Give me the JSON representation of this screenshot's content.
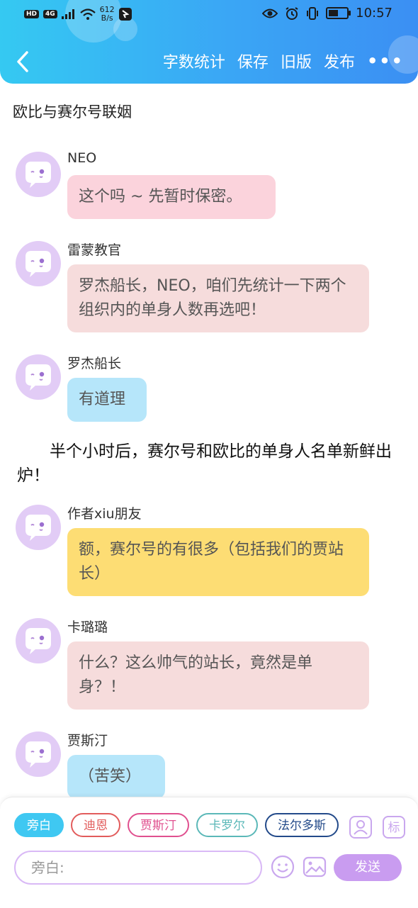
{
  "status_bar": {
    "hd": "HD",
    "net": "4G",
    "speed_value": "612",
    "speed_unit": "B/s",
    "time": "10:57",
    "battery_level": 0.55
  },
  "header": {
    "actions": [
      "字数统计",
      "保存",
      "旧版",
      "发布"
    ],
    "more": "•••"
  },
  "doc_title": "欧比与赛尔号联姻",
  "messages": [
    {
      "name": "NEO",
      "text": "这个吗 ~ 先暂时保密。",
      "color": "#fbd3dc"
    },
    {
      "name": "雷蒙教官",
      "text": "罗杰船长，NEO，咱们先统计一下两个组织内的单身人数再选吧！",
      "color": "#f6dcdc"
    },
    {
      "name": "罗杰船长",
      "text": "有道理",
      "color": "#b6e6fa"
    },
    {
      "name": "作者xiu朋友",
      "text": "额，赛尔号的有很多（包括我们的贾站长）",
      "color": "#fddd74"
    },
    {
      "name": "卡璐璐",
      "text": "什么？这么帅气的站长，竟然是单身？！",
      "color": "#f6dcdc"
    },
    {
      "name": "贾斯汀",
      "text": "（苦笑）",
      "color": "#b6e6fa"
    }
  ],
  "narration": "　　半个小时后，赛尔号和欧比的单身人名单新鲜出炉！",
  "roles": [
    {
      "label": "旁白",
      "color": "#3fc8f2"
    },
    {
      "label": "迪恩",
      "color": "#e25c5c"
    },
    {
      "label": "贾斯汀",
      "color": "#e0508f"
    },
    {
      "label": "卡罗尔",
      "color": "#5bb8b8"
    },
    {
      "label": "法尔多斯",
      "color": "#234a8a"
    }
  ],
  "tools": {
    "mark_label": "标"
  },
  "input": {
    "placeholder": "旁白:"
  },
  "send_label": "发送"
}
